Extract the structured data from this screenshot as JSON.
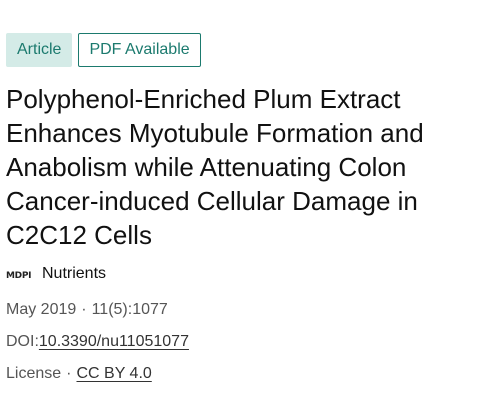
{
  "badges": {
    "article": "Article",
    "pdf": "PDF Available"
  },
  "title": "Polyphenol-Enriched Plum Extract Enhances Myotubule Formation and Anabolism while Attenuating Colon Cancer-induced Cellular Damage in C2C12 Cells",
  "journal": {
    "logo_text": "MDPI",
    "name": "Nutrients"
  },
  "meta": {
    "date": "May 2019",
    "separator": "·",
    "issue": "11(5):1077",
    "doi_label": "DOI:",
    "doi": "10.3390/nu11051077",
    "license_label": "License",
    "license": "CC BY 4.0"
  },
  "colors": {
    "accent": "#1b7a6e",
    "badge_bg": "#d4ebe7"
  },
  "icons": {
    "publisher": "mdpi-logo-icon"
  }
}
